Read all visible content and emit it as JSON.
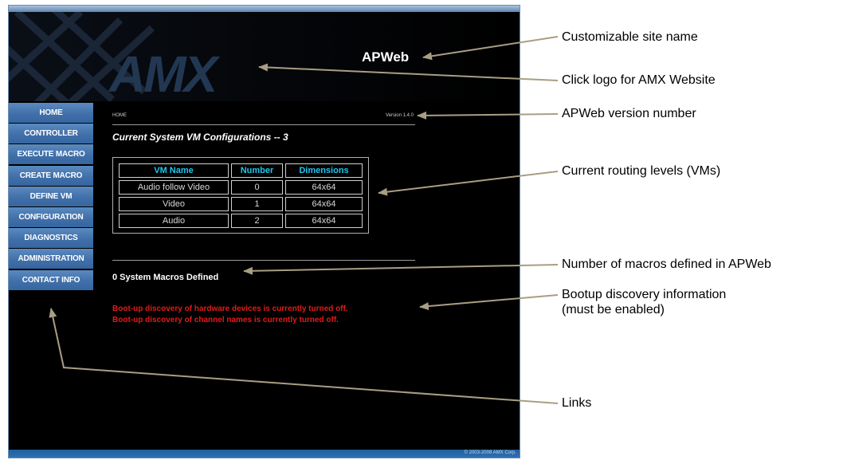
{
  "header": {
    "logo_text": "AMX",
    "site_name": "APWeb"
  },
  "sidebar": {
    "items": [
      {
        "label": "HOME"
      },
      {
        "label": "CONTROLLER"
      },
      {
        "label": "EXECUTE MACRO"
      },
      {
        "label": "CREATE MACRO"
      },
      {
        "label": "DEFINE VM"
      },
      {
        "label": "CONFIGURATION"
      },
      {
        "label": "DIAGNOSTICS"
      },
      {
        "label": "ADMINISTRATION"
      },
      {
        "label": "CONTACT INFO"
      }
    ]
  },
  "main": {
    "breadcrumb": "HOME",
    "version": "Version 1.4.0",
    "config_title": "Current System VM Configurations -- 3",
    "table": {
      "columns": [
        "VM Name",
        "Number",
        "Dimensions"
      ],
      "rows": [
        [
          "Audio follow Video",
          "0",
          "64x64"
        ],
        [
          "Video",
          "1",
          "64x64"
        ],
        [
          "Audio",
          "2",
          "64x64"
        ]
      ]
    },
    "macros_text": "0 System Macros Defined",
    "boot_messages": [
      "Boot-up discovery of hardware devices is currently turned off.",
      "Boot-up discovery of channel names is currently turned off."
    ]
  },
  "footer": {
    "copyright": "© 2003-2008 AMX Corp."
  },
  "annotations": {
    "site_name": "Customizable site name",
    "logo": "Click logo for AMX Website",
    "version": "APWeb version number",
    "routing": "Current routing levels (VMs)",
    "macros": "Number of macros defined in APWeb",
    "bootup_line1": "Bootup discovery information",
    "bootup_line2": "(must be enabled)",
    "links": "Links"
  },
  "colors": {
    "nav_button": "#4a7bb5",
    "header_rule": "#2f6db3",
    "table_header_text": "#1ec6ee",
    "warning_text": "#e11b1b",
    "callout_arrow": "#a89e84"
  }
}
